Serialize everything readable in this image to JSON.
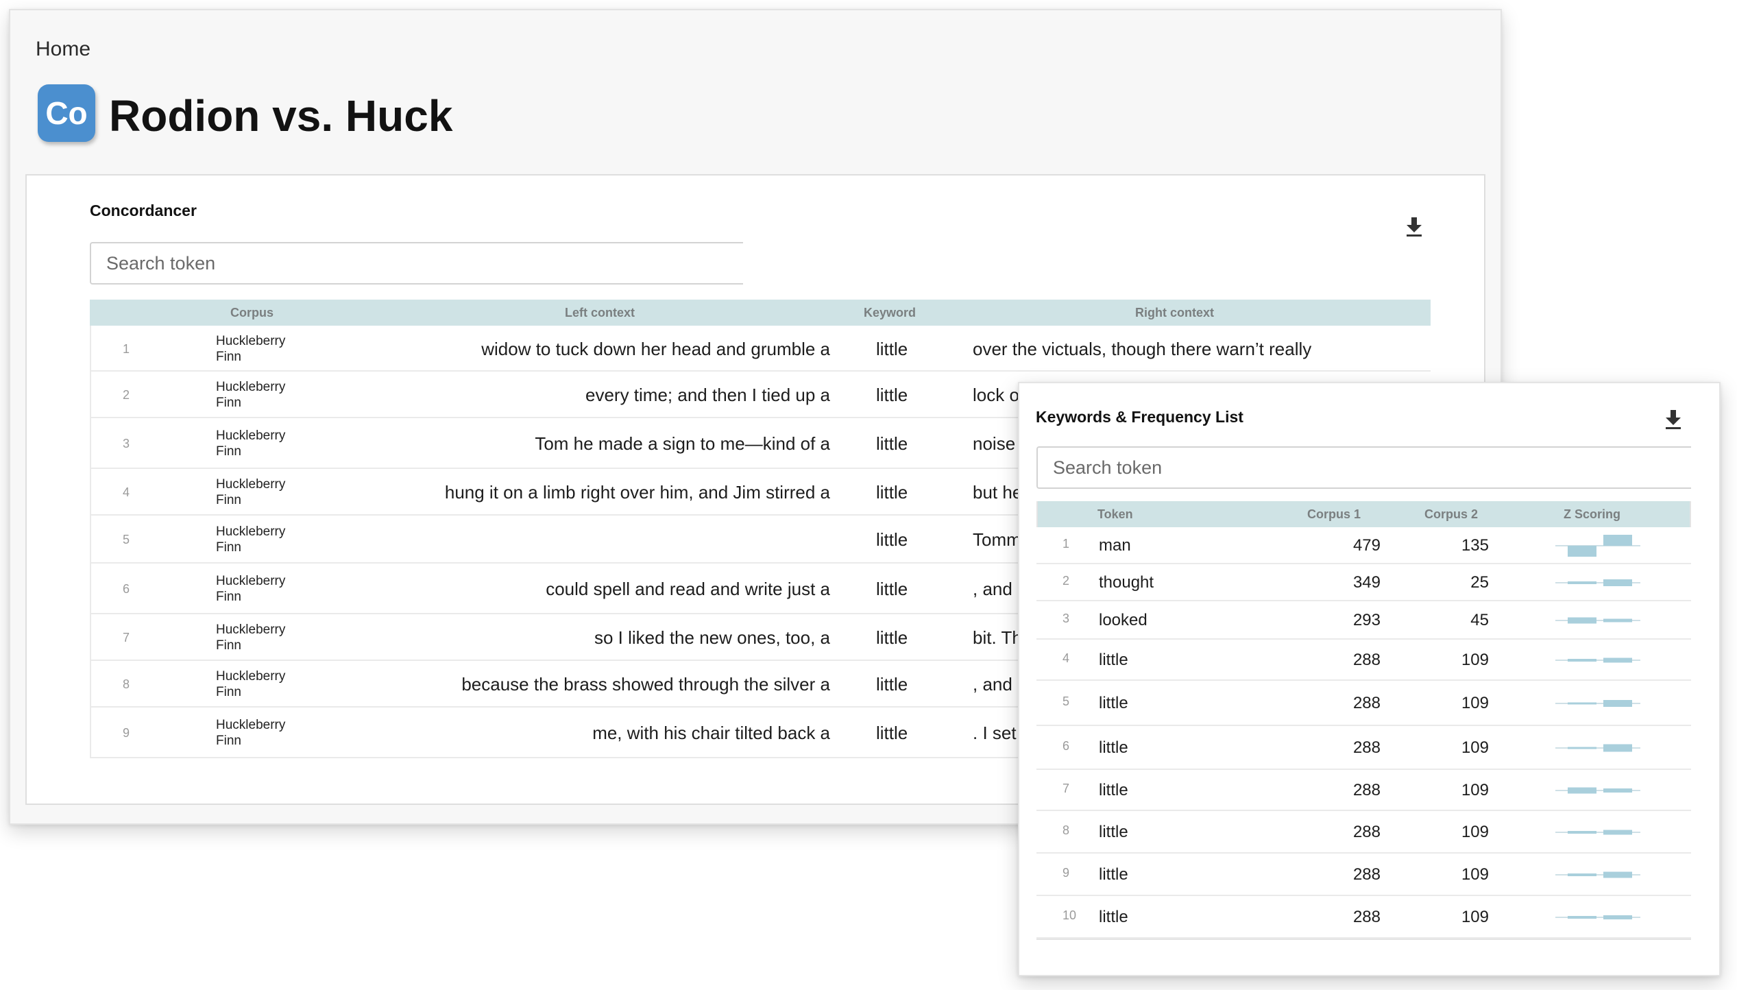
{
  "header": {
    "breadcrumb": "Home",
    "logo_text": "Co",
    "title": "Rodion vs. Huck"
  },
  "concordancer": {
    "title": "Concordancer",
    "search_placeholder": "Search token",
    "columns": {
      "corpus": "Corpus",
      "left": "Left context",
      "keyword": "Keyword",
      "right": "Right context"
    },
    "rows": [
      {
        "n": "1",
        "corpus_line1": "Huckleberry",
        "corpus_line2": "Finn",
        "left": "widow to tuck down her head and grumble a",
        "keyword": "little",
        "right": "over the victuals, though there warn’t really"
      },
      {
        "n": "2",
        "corpus_line1": "Huckleberry",
        "corpus_line2": "Finn",
        "left": "every time; and then I tied up a",
        "keyword": "little",
        "right": "lock of"
      },
      {
        "n": "3",
        "corpus_line1": "Huckleberry",
        "corpus_line2": "Finn",
        "left": "Tom he made a sign to me—kind of a",
        "keyword": "little",
        "right": "noise w"
      },
      {
        "n": "4",
        "corpus_line1": "Huckleberry",
        "corpus_line2": "Finn",
        "left": "hung it on a limb right over him, and Jim stirred a",
        "keyword": "little",
        "right": "but he"
      },
      {
        "n": "5",
        "corpus_line1": "Huckleberry",
        "corpus_line2": "Finn",
        "left": "",
        "keyword": "little",
        "right": "Tomm"
      },
      {
        "n": "6",
        "corpus_line1": "Huckleberry",
        "corpus_line2": "Finn",
        "left": "could spell and read and write just a",
        "keyword": "little",
        "right": ", and c"
      },
      {
        "n": "7",
        "corpus_line1": "Huckleberry",
        "corpus_line2": "Finn",
        "left": "so I liked the new ones, too, a",
        "keyword": "little",
        "right": "bit. Th"
      },
      {
        "n": "8",
        "corpus_line1": "Huckleberry",
        "corpus_line2": "Finn",
        "left": "because the brass showed through the silver a",
        "keyword": "little",
        "right": ", and i"
      },
      {
        "n": "9",
        "corpus_line1": "Huckleberry",
        "corpus_line2": "Finn",
        "left": "me, with his chair tilted back a",
        "keyword": "little",
        "right": ". I set t"
      }
    ]
  },
  "keywords": {
    "title": "Keywords & Frequency List",
    "search_placeholder": "Search token",
    "columns": {
      "token": "Token",
      "corpus1": "Corpus 1",
      "corpus2": "Corpus 2",
      "zscore": "Z Scoring"
    },
    "rows": [
      {
        "n": "1",
        "token": "man",
        "c1": "479",
        "c2": "135"
      },
      {
        "n": "2",
        "token": "thought",
        "c1": "349",
        "c2": "25"
      },
      {
        "n": "3",
        "token": "looked",
        "c1": "293",
        "c2": "45"
      },
      {
        "n": "4",
        "token": "little",
        "c1": "288",
        "c2": "109"
      },
      {
        "n": "5",
        "token": "little",
        "c1": "288",
        "c2": "109"
      },
      {
        "n": "6",
        "token": "little",
        "c1": "288",
        "c2": "109"
      },
      {
        "n": "7",
        "token": "little",
        "c1": "288",
        "c2": "109"
      },
      {
        "n": "8",
        "token": "little",
        "c1": "288",
        "c2": "109"
      },
      {
        "n": "9",
        "token": "little",
        "c1": "288",
        "c2": "109"
      },
      {
        "n": "10",
        "token": "little",
        "c1": "288",
        "c2": "109"
      }
    ]
  },
  "colors": {
    "accent": "#4b8fcf",
    "table_header": "#cfe3e5",
    "spark": "#a9cfdc"
  },
  "icons": {
    "download": "download-icon"
  }
}
